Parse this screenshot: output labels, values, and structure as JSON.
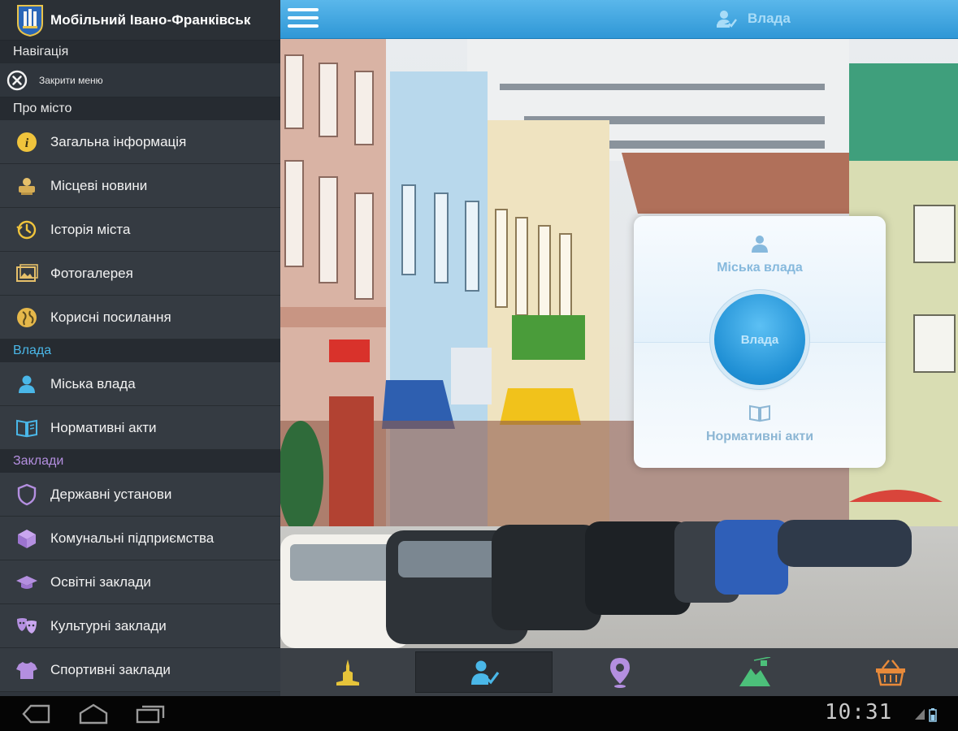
{
  "app": {
    "title": "Мобільний Івано-Франківськ"
  },
  "sidebar": {
    "nav_header": "Навігація",
    "close_menu": "Закрити меню",
    "sections": [
      {
        "header": "Про місто",
        "color": "#4ab7e8",
        "items": [
          {
            "label": "Загальна інформація",
            "icon": "info-icon"
          },
          {
            "label": "Місцеві новини",
            "icon": "news-icon"
          },
          {
            "label": "Історія міста",
            "icon": "history-icon"
          },
          {
            "label": "Фотогалерея",
            "icon": "gallery-icon"
          },
          {
            "label": "Корисні посилання",
            "icon": "globe-icon"
          }
        ]
      },
      {
        "header": "Влада",
        "color": "#4ab7e8",
        "items": [
          {
            "label": "Міська влада",
            "icon": "person-icon"
          },
          {
            "label": "Нормативні акти",
            "icon": "book-icon"
          }
        ]
      },
      {
        "header": "Заклади",
        "color": "#b48fe0",
        "items": [
          {
            "label": "Державні установи",
            "icon": "shield-icon"
          },
          {
            "label": "Комунальні підприємства",
            "icon": "box-icon"
          },
          {
            "label": "Освітні заклади",
            "icon": "graduation-cap-icon"
          },
          {
            "label": "Культурні заклади",
            "icon": "theater-masks-icon"
          },
          {
            "label": "Спортивні заклади",
            "icon": "tshirt-icon"
          }
        ]
      }
    ]
  },
  "topbar": {
    "title": "Влада",
    "icon": "person-check-icon"
  },
  "card": {
    "city_gov": "Міська влада",
    "center": "Влада",
    "normative": "Нормативні акти"
  },
  "tabbar": {
    "tabs": [
      {
        "icon": "city-hall-icon",
        "color": "#e6c43a",
        "active": false
      },
      {
        "icon": "person-check-icon",
        "color": "#4ab7e8",
        "active": true
      },
      {
        "icon": "map-pin-icon",
        "color": "#b48fe0",
        "active": false
      },
      {
        "icon": "mountain-cablecar-icon",
        "color": "#4cc07a",
        "active": false
      },
      {
        "icon": "basket-icon",
        "color": "#e88a3a",
        "active": false
      }
    ]
  },
  "system": {
    "clock": "10:31"
  }
}
